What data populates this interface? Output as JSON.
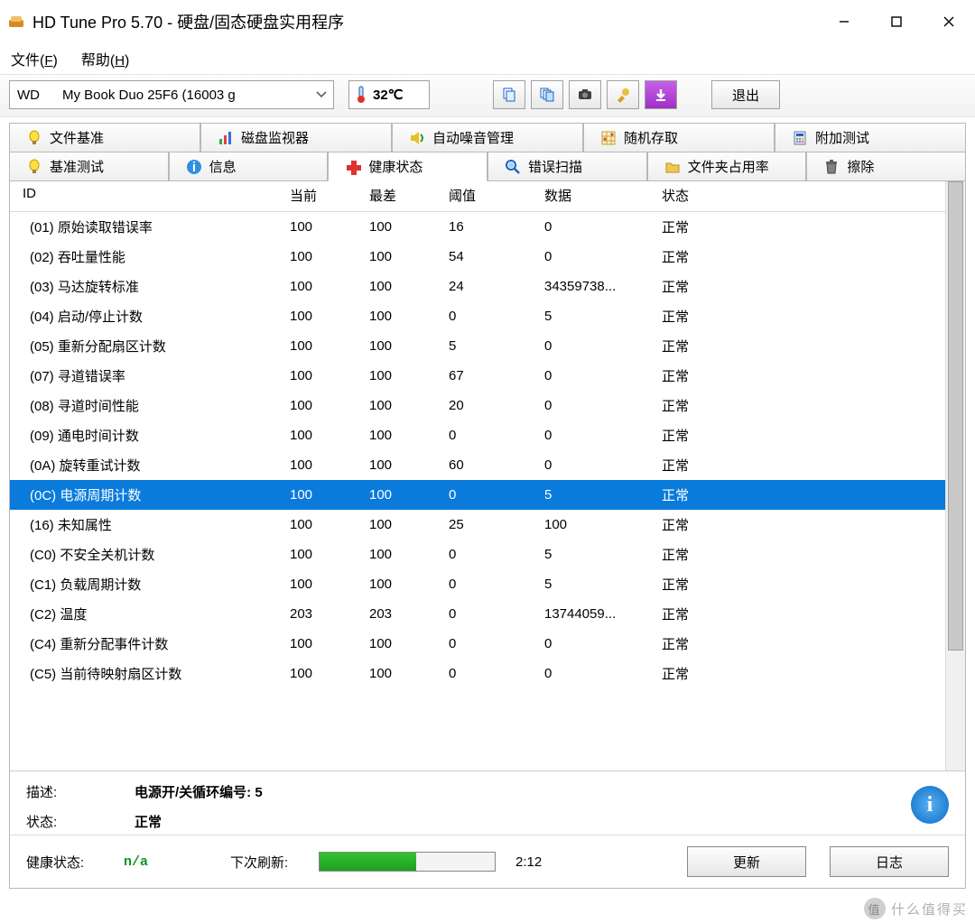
{
  "window": {
    "title": "HD Tune Pro 5.70 - 硬盘/固态硬盘实用程序"
  },
  "menu": {
    "file": "文件(F)",
    "help": "帮助(H)"
  },
  "toolbar": {
    "drive": "WD      My Book Duo 25F6 (16003 g",
    "temp": "32℃",
    "exit": "退出"
  },
  "tabs": {
    "row1": [
      {
        "label": "文件基准",
        "icon": "lightbulb"
      },
      {
        "label": "磁盘监视器",
        "icon": "bars"
      },
      {
        "label": "自动噪音管理",
        "icon": "speaker"
      },
      {
        "label": "随机存取",
        "icon": "grid"
      },
      {
        "label": "附加测试",
        "icon": "calc"
      }
    ],
    "row2": [
      {
        "label": "基准测试",
        "icon": "bulb2"
      },
      {
        "label": "信息",
        "icon": "info"
      },
      {
        "label": "健康状态",
        "icon": "plus",
        "active": true
      },
      {
        "label": "错误扫描",
        "icon": "search"
      },
      {
        "label": "文件夹占用率",
        "icon": "folder"
      },
      {
        "label": "擦除",
        "icon": "trash"
      }
    ]
  },
  "table": {
    "headers": {
      "id": "ID",
      "current": "当前",
      "worst": "最差",
      "threshold": "阈值",
      "data": "数据",
      "status": "状态"
    },
    "rows": [
      {
        "id": "(01) 原始读取错误率",
        "cur": "100",
        "worst": "100",
        "thr": "16",
        "data": "0",
        "stat": "正常"
      },
      {
        "id": "(02) 吞吐量性能",
        "cur": "100",
        "worst": "100",
        "thr": "54",
        "data": "0",
        "stat": "正常"
      },
      {
        "id": "(03) 马达旋转标准",
        "cur": "100",
        "worst": "100",
        "thr": "24",
        "data": "34359738...",
        "stat": "正常"
      },
      {
        "id": "(04) 启动/停止计数",
        "cur": "100",
        "worst": "100",
        "thr": "0",
        "data": "5",
        "stat": "正常"
      },
      {
        "id": "(05) 重新分配扇区计数",
        "cur": "100",
        "worst": "100",
        "thr": "5",
        "data": "0",
        "stat": "正常"
      },
      {
        "id": "(07) 寻道错误率",
        "cur": "100",
        "worst": "100",
        "thr": "67",
        "data": "0",
        "stat": "正常"
      },
      {
        "id": "(08) 寻道时间性能",
        "cur": "100",
        "worst": "100",
        "thr": "20",
        "data": "0",
        "stat": "正常"
      },
      {
        "id": "(09) 通电时间计数",
        "cur": "100",
        "worst": "100",
        "thr": "0",
        "data": "0",
        "stat": "正常"
      },
      {
        "id": "(0A) 旋转重试计数",
        "cur": "100",
        "worst": "100",
        "thr": "60",
        "data": "0",
        "stat": "正常"
      },
      {
        "id": "(0C) 电源周期计数",
        "cur": "100",
        "worst": "100",
        "thr": "0",
        "data": "5",
        "stat": "正常",
        "selected": true
      },
      {
        "id": "(16) 未知属性",
        "cur": "100",
        "worst": "100",
        "thr": "25",
        "data": "100",
        "stat": "正常"
      },
      {
        "id": "(C0) 不安全关机计数",
        "cur": "100",
        "worst": "100",
        "thr": "0",
        "data": "5",
        "stat": "正常"
      },
      {
        "id": "(C1) 负载周期计数",
        "cur": "100",
        "worst": "100",
        "thr": "0",
        "data": "5",
        "stat": "正常"
      },
      {
        "id": "(C2) 温度",
        "cur": "203",
        "worst": "203",
        "thr": "0",
        "data": "13744059...",
        "stat": "正常"
      },
      {
        "id": "(C4) 重新分配事件计数",
        "cur": "100",
        "worst": "100",
        "thr": "0",
        "data": "0",
        "stat": "正常"
      },
      {
        "id": "(C5) 当前待映射扇区计数",
        "cur": "100",
        "worst": "100",
        "thr": "0",
        "data": "0",
        "stat": "正常"
      }
    ]
  },
  "desc": {
    "label1": "描述:",
    "value1": "电源开/关循环编号: 5",
    "label2": "状态:",
    "value2": "正常"
  },
  "footer": {
    "health_label": "健康状态:",
    "health_value": "n/a",
    "refresh_label": "下次刷新:",
    "time": "2:12",
    "update": "更新",
    "log": "日志"
  },
  "watermark": "什么值得买"
}
